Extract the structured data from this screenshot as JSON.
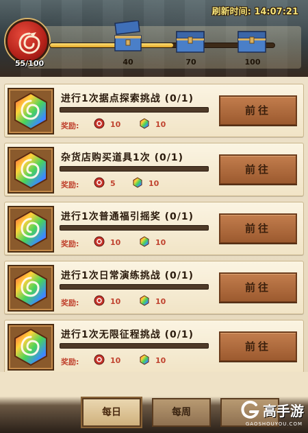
{
  "header": {
    "refresh_text": "刷新时间: 14:07:21",
    "points_value": "55/100",
    "progress": 0.55,
    "milestones": [
      {
        "label": "40",
        "icon": "open-chest-icon"
      },
      {
        "label": "70",
        "icon": "treasure-chest-icon"
      },
      {
        "label": "100",
        "icon": "treasure-chest-icon"
      }
    ]
  },
  "tasks": [
    {
      "title": "进行1次据点探索挑战 (0/1)",
      "reward_label": "奖励:",
      "reward1": "10",
      "reward2": "10",
      "button": "前往"
    },
    {
      "title": "杂货店购买道具1次 (0/1)",
      "reward_label": "奖励:",
      "reward1": "5",
      "reward2": "10",
      "button": "前往"
    },
    {
      "title": "进行1次普通福引摇奖 (0/1)",
      "reward_label": "奖励:",
      "reward1": "10",
      "reward2": "10",
      "button": "前往"
    },
    {
      "title": "进行1次日常演练挑战 (0/1)",
      "reward_label": "奖励:",
      "reward1": "10",
      "reward2": "10",
      "button": "前往"
    },
    {
      "title": "进行1次无限征程挑战 (0/1)",
      "reward_label": "奖励:",
      "reward1": "10",
      "reward2": "10",
      "button": "前往"
    }
  ],
  "tabs": {
    "daily": "每日",
    "weekly": "每周"
  },
  "watermark": {
    "text": "高手游",
    "sub": "GAOSHOUYOU.COM"
  },
  "colors": {
    "accent_red": "#c0432f",
    "button_brown": "#b06c3e",
    "gold": "#f4e27a"
  }
}
